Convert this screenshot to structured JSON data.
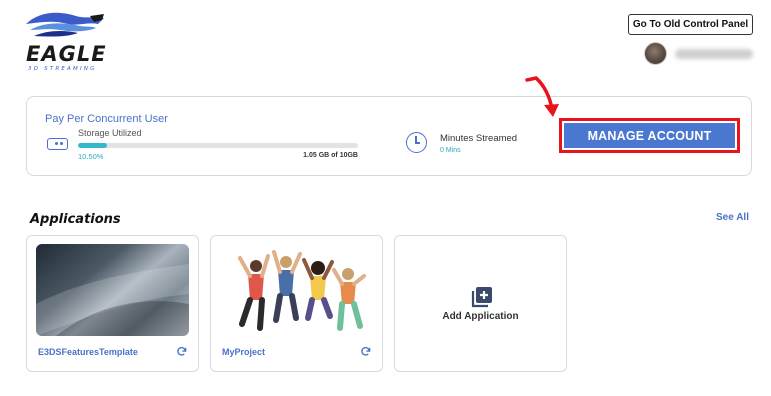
{
  "brand": {
    "name": "EAGLE",
    "tagline": "3D STREAMING"
  },
  "header": {
    "old_panel_label": "Go To Old Control Panel",
    "user_name": "████████"
  },
  "usage": {
    "plan_title": "Pay Per Concurrent User",
    "storage_label": "Storage Utilized",
    "storage_percent_text": "10.50%",
    "storage_percent_value": 10.5,
    "storage_amount": "1.05 GB of 10GB",
    "minutes_label": "Minutes Streamed",
    "minutes_value": "0 Mins",
    "manage_label": "MANAGE ACCOUNT"
  },
  "applications": {
    "heading": "Applications",
    "see_all": "See All",
    "items": [
      {
        "name": "E3DSFeaturesTemplate"
      },
      {
        "name": "MyProject"
      }
    ],
    "add_label": "Add Application"
  },
  "colors": {
    "accent": "#4a72c8",
    "button": "#4a78d0",
    "highlight": "#e8141d",
    "progress": "#35b8c9"
  },
  "icons": [
    "storage-icon",
    "clock-icon",
    "refresh-icon",
    "add-application-icon",
    "red-arrow-icon"
  ]
}
